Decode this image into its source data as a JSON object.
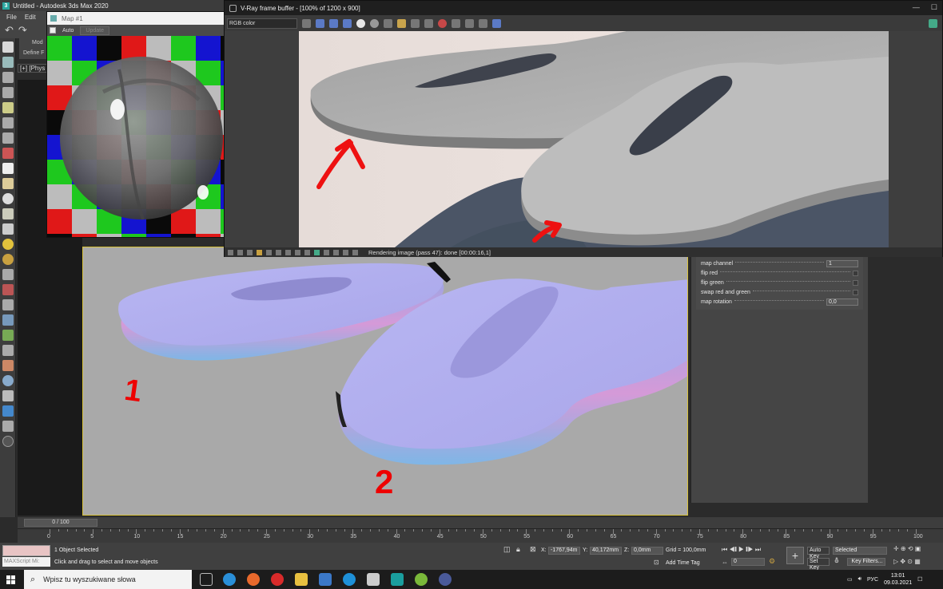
{
  "max": {
    "title": "Untitled - Autodesk 3ds Max 2020",
    "logo": "3",
    "menu": [
      "File",
      "Edit"
    ],
    "viewport_label": "[+] [Phys",
    "cmd_tabs": [
      "Mod",
      "Define F"
    ]
  },
  "map_window": {
    "title": "Map #1",
    "auto_label": "Auto",
    "update_label": "Update"
  },
  "vfb": {
    "title": "V-Ray frame buffer - [100% of 1200 x 900]",
    "channel": "RGB color",
    "status": "Rendering image (pass 47): done [00:00:16,1]"
  },
  "params": {
    "rows": [
      {
        "label": "map channel",
        "value": "1"
      },
      {
        "label": "flip red",
        "value": ""
      },
      {
        "label": "flip green",
        "value": ""
      },
      {
        "label": "swap red and green",
        "value": ""
      },
      {
        "label": "map rotation",
        "value": "0,0"
      }
    ]
  },
  "annotations": {
    "num1": "1",
    "num2": "2"
  },
  "timeline": {
    "slider": "0 / 100",
    "ticks": [
      "0",
      "5",
      "10",
      "15",
      "20",
      "25",
      "30",
      "35",
      "40",
      "45",
      "50",
      "55",
      "60",
      "65",
      "70",
      "75",
      "80",
      "85",
      "90",
      "95",
      "100"
    ]
  },
  "status": {
    "maxscript": "MAXScript Mi:",
    "selection": "1 Object Selected",
    "prompt": "Click and drag to select and move objects",
    "x_label": "X:",
    "x": "-1767,94m",
    "y_label": "Y:",
    "y": "40,172mm",
    "z_label": "Z:",
    "z": "0,0mm",
    "grid": "Grid = 100,0mm",
    "add_time_tag": "Add Time Tag",
    "auto_key": "Auto Key",
    "set_key": "Set Key",
    "key_mode": "Selected",
    "key_filters": "Key Filters...",
    "frame": "0"
  },
  "taskbar": {
    "search_placeholder": "Wpisz tu wyszukiwane słowa",
    "lang": "РУС",
    "time": "13:01",
    "date": "09.03.2021"
  }
}
